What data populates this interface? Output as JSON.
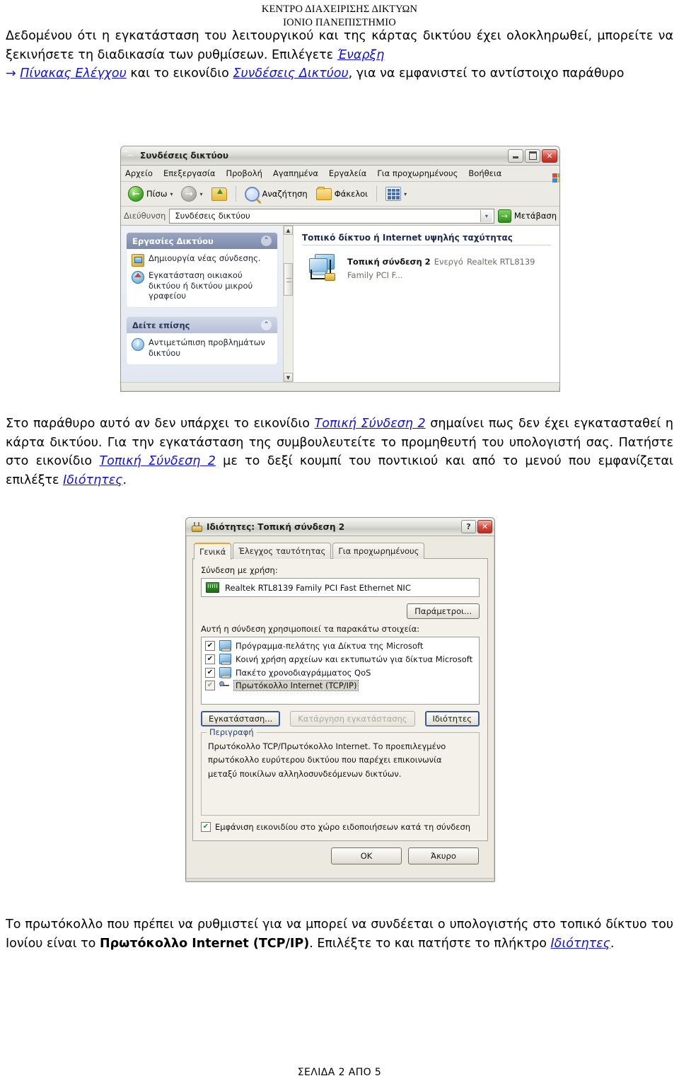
{
  "document": {
    "header_line1": "ΚΕΝΤΡΟ ΔΙΑΧΕΙΡΙΣΗΣ ΔΙΚΤΥΩΝ",
    "header_line2": "ΙΟΝΙΟ ΠΑΝΕΠΙΣΤΗΜΙΟ",
    "footer": "ΣΕΛΙΔΑ 2 ΑΠΟ 5",
    "paragraph1": {
      "t1": "Δεδομένου ότι η εγκατάσταση του λειτουργικού και της κάρτας δικτύου έχει ολοκληρωθεί, μπορείτε να ξεκινήσετε τη διαδικασία των ρυθμίσεων. Επιλέγετε ",
      "link1": "Έναρξη",
      "arrow": "→",
      "link2": "Πίνακας Ελέγχου",
      "t2": " και το εικονίδιο ",
      "link3": "Συνδέσεις Δικτύου",
      "t3": ", για να εμφανιστεί το αντίστοιχο παράθυρο"
    },
    "paragraph2": {
      "t1": "Στο παράθυρο αυτό αν δεν υπάρχει το εικονίδιο ",
      "link1": "Τοπική Σύνδεση 2",
      "t2": " σημαίνει πως δεν έχει εγκατασταθεί η κάρτα δικτύου. Για την εγκατάσταση της συμβουλευτείτε το προμηθευτή του υπολογιστή σας. Πατήστε στο εικονίδιο ",
      "link2": "Τοπική Σύνδεση 2",
      "t3": " με το δεξί κουμπί του ποντικιού και από το μενού που εμφανίζεται επιλέξτε ",
      "link3": "Ιδιότητες",
      "t4": "."
    },
    "paragraph3": {
      "t1": "Το πρωτόκολλο που πρέπει να ρυθμιστεί για να μπορεί να συνδέεται ο υπολογιστής στο τοπικό δίκτυο του Ιονίου είναι το ",
      "bold1": "Πρωτόκολλο Internet (TCP/IP)",
      "t2": ". Επιλέξτε το και πατήστε το πλήκτρο ",
      "link1": "Ιδιότητες",
      "t3": "."
    }
  },
  "network_window": {
    "title": "Συνδέσεις δικτύου",
    "buttons": {
      "minimize": "–",
      "maximize": "❑",
      "close": "✕"
    },
    "menu": [
      "Αρχείο",
      "Επεξεργασία",
      "Προβολή",
      "Αγαπημένα",
      "Εργαλεία",
      "Για προχωρημένους",
      "Βοήθεια"
    ],
    "toolbar": {
      "back": "Πίσω",
      "search": "Αναζήτηση",
      "folders": "Φάκελοι",
      "caret": "▾"
    },
    "address": {
      "label": "Διεύθυνση",
      "value": "Συνδέσεις δικτύου",
      "dropdown": "▾",
      "go": "Μετάβαση",
      "go_arrow": "→"
    },
    "task_panel": {
      "title": "Εργασίες Δικτύου",
      "collapse": "⌃",
      "items": [
        "Δημιουργία νέας σύνδεσης.",
        "Εγκατάσταση οικιακού δικτύου ή δικτύου μικρού γραφείου"
      ]
    },
    "see_also_panel": {
      "title": "Δείτε επίσης",
      "collapse": "⌃",
      "items": [
        "Αντιμετώπιση προβλημάτων δικτύου"
      ]
    },
    "content": {
      "group_header": "Τοπικό δίκτυο ή Internet υψηλής ταχύτητας",
      "connection": {
        "name": "Τοπική σύνδεση 2",
        "status": "Ενεργό",
        "adapter": "Realtek RTL8139 Family PCI F..."
      }
    },
    "scrollbar": {
      "up": "▲",
      "down": "▼"
    }
  },
  "properties_dialog": {
    "title": "Ιδιότητες: Τοπική σύνδεση 2",
    "help_button": "?",
    "close_button": "✕",
    "tabs": [
      {
        "label": "Γενικά",
        "active": true
      },
      {
        "label": "Έλεγχος ταυτότητας",
        "active": false
      },
      {
        "label": "Για προχωρημένους",
        "active": false
      }
    ],
    "connect_using_label": "Σύνδεση με χρήση:",
    "adapter": "Realtek RTL8139 Family PCI Fast Ethernet NIC",
    "configure_button": "Παράμετροι...",
    "components_label": "Αυτή η σύνδεση χρησιμοποιεί τα παρακάτω στοιχεία:",
    "components": [
      {
        "label": "Πρόγραμμα-πελάτης για Δίκτυα της Microsoft",
        "checked": true,
        "selected": false,
        "icon": "pc"
      },
      {
        "label": "Κοινή χρήση αρχείων και εκτυπωτών για δίκτυα Microsoft",
        "checked": true,
        "selected": false,
        "icon": "pc"
      },
      {
        "label": "Πακέτο χρονοδιαγράμματος QoS",
        "checked": true,
        "selected": false,
        "icon": "pc"
      },
      {
        "label": "Πρωτόκολλο Internet (TCP/IP)",
        "checked": true,
        "selected": true,
        "icon": "net"
      }
    ],
    "check_mark": "✔",
    "install_button": "Εγκατάσταση...",
    "uninstall_button": "Κατάργηση εγκατάστασης",
    "properties_button": "Ιδιότητες",
    "description_legend": "Περιγραφή",
    "description_text": "Πρωτόκολλο TCP/Πρωτόκολλο Internet. Το προεπιλεγμένο πρωτόκολλο ευρύτερου δικτύου που παρέχει επικοινωνία μεταξύ ποικίλων αλληλοσυνδεόμενων δικτύων.",
    "notify_checkbox": {
      "label": "Εμφάνιση εικονιδίου στο χώρο ειδοποιήσεων κατά τη σύνδεση",
      "checked": true
    },
    "ok_button": "OK",
    "cancel_button": "Άκυρο"
  },
  "colors": {
    "link": "#1414c8",
    "text": "#000000",
    "title_bar": "#dcdcd6",
    "panel_header": "#7b89ad",
    "close_red": "#d4483c"
  }
}
